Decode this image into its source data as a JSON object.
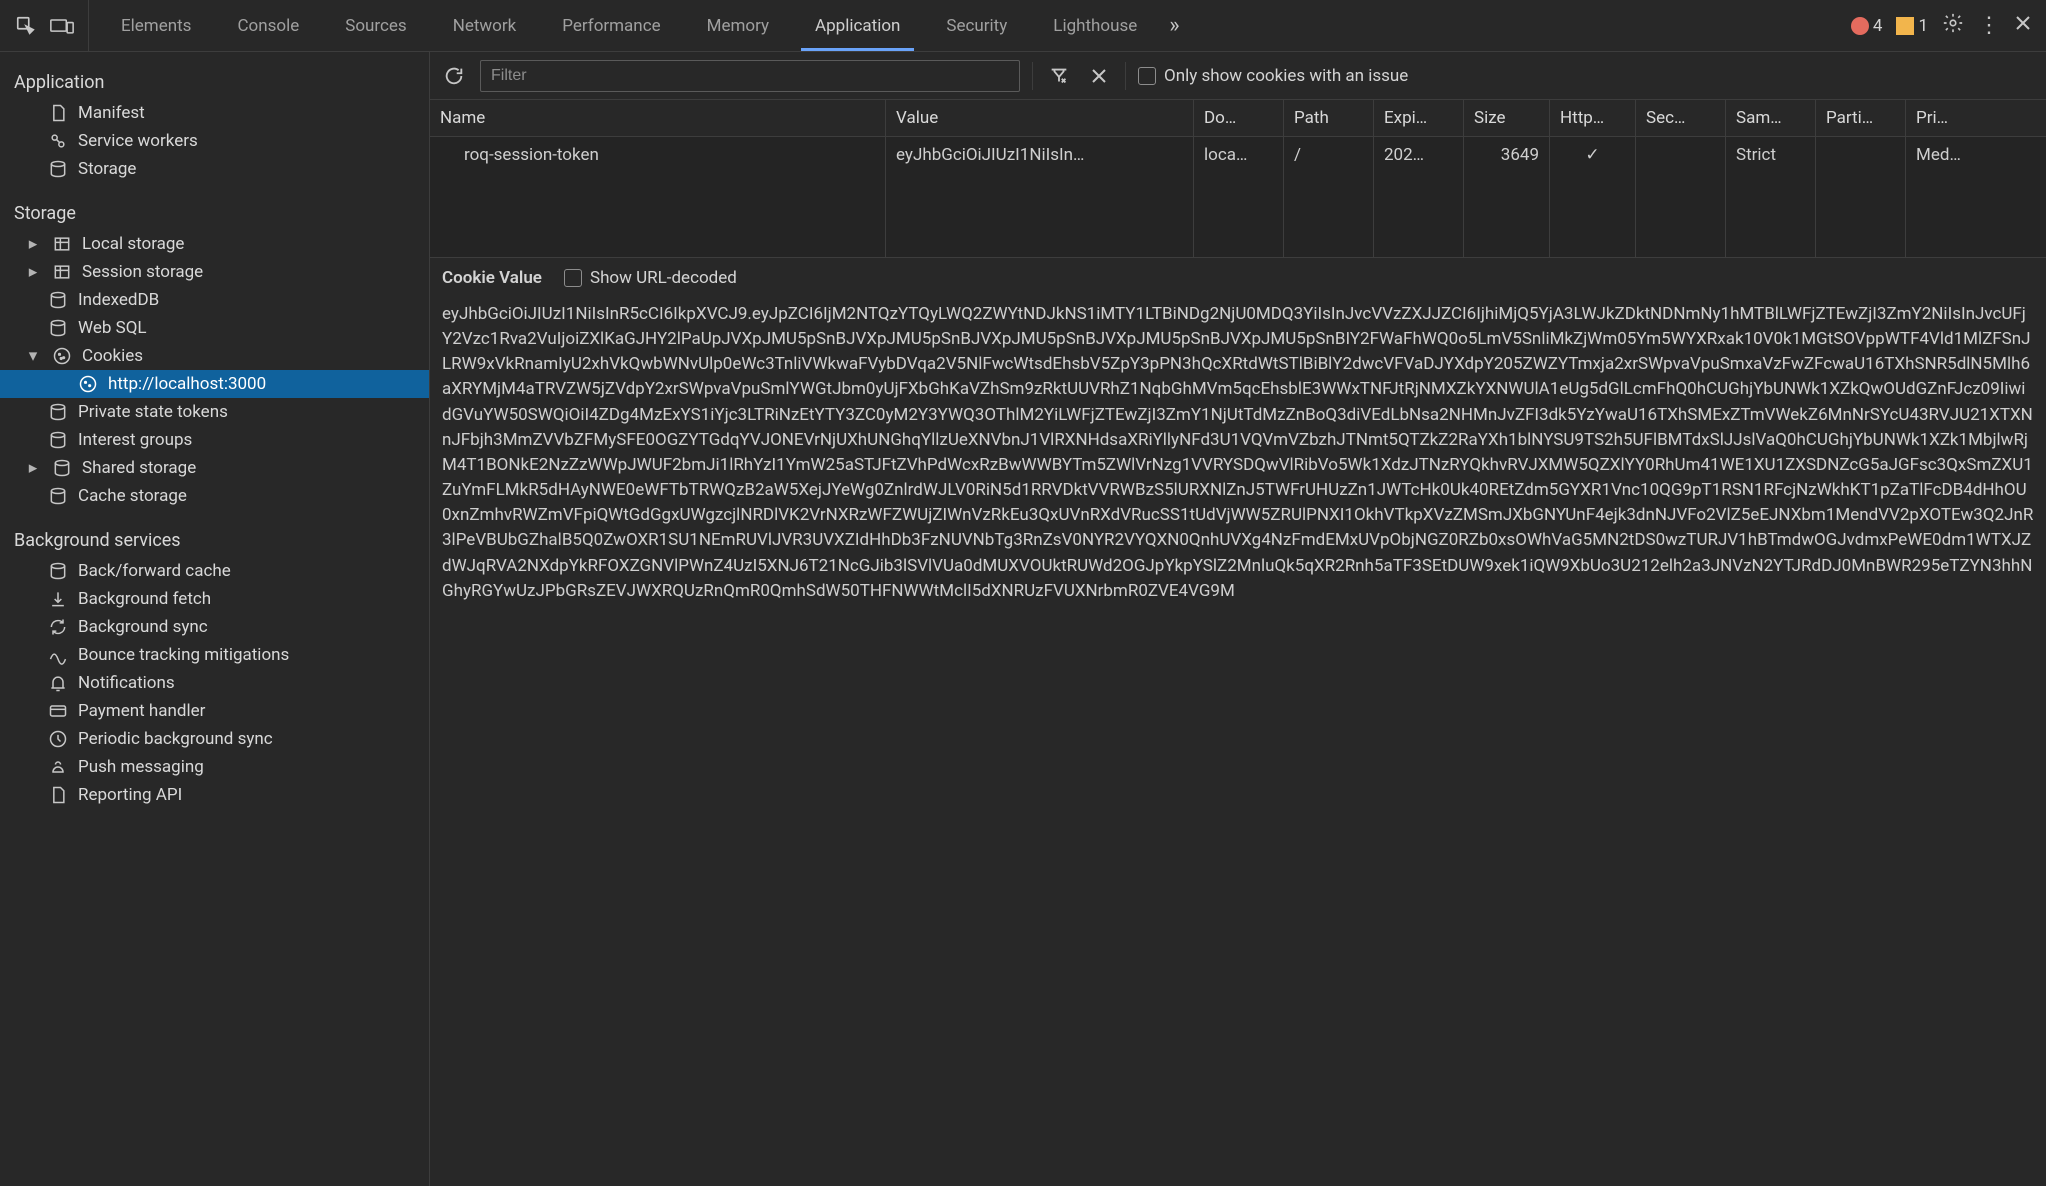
{
  "tabs": {
    "items": [
      "Elements",
      "Console",
      "Sources",
      "Network",
      "Performance",
      "Memory",
      "Application",
      "Security",
      "Lighthouse"
    ],
    "active": "Application"
  },
  "top_right": {
    "error_count": "4",
    "warn_count": "1"
  },
  "sidebar": {
    "sections": {
      "application": {
        "title": "Application",
        "items": [
          "Manifest",
          "Service workers",
          "Storage"
        ]
      },
      "storage": {
        "title": "Storage",
        "items": {
          "local_storage": "Local storage",
          "session_storage": "Session storage",
          "indexeddb": "IndexedDB",
          "websql": "Web SQL",
          "cookies": "Cookies",
          "cookies_child": "http://localhost:3000",
          "private_state_tokens": "Private state tokens",
          "interest_groups": "Interest groups",
          "shared_storage": "Shared storage",
          "cache_storage": "Cache storage"
        }
      },
      "background": {
        "title": "Background services",
        "items": [
          "Back/forward cache",
          "Background fetch",
          "Background sync",
          "Bounce tracking mitigations",
          "Notifications",
          "Payment handler",
          "Periodic background sync",
          "Push messaging",
          "Reporting API"
        ]
      }
    }
  },
  "toolbar": {
    "filter_placeholder": "Filter",
    "only_issue_label": "Only show cookies with an issue"
  },
  "table": {
    "headers": [
      "Name",
      "Value",
      "Do…",
      "Path",
      "Expi…",
      "Size",
      "Http…",
      "Sec…",
      "Sam…",
      "Parti…",
      "Pri…"
    ],
    "rows": [
      {
        "name": "roq-session-token",
        "value": "eyJhbGciOiJIUzI1NiIsIn…",
        "domain": "loca…",
        "path": "/",
        "expires": "202…",
        "size": "3649",
        "httponly": "✓",
        "secure": "",
        "samesite": "Strict",
        "partition": "",
        "priority": "Med…"
      }
    ]
  },
  "detail": {
    "label": "Cookie Value",
    "show_decoded_label": "Show URL-decoded",
    "value": "eyJhbGciOiJIUzI1NiIsInR5cCI6IkpXVCJ9.eyJpZCI6IjM2NTQzYTQyLWQ2ZWYtNDJkNS1iMTY1LTBiNDg2NjU0MDQ3YiIsInJvcVVzZXJJZCI6IjhiMjQ5YjA3LWJkZDktNDNmNy1hMTBlLWFjZTEwZjI3ZmY2NiIsInJvcUFjY2Vzc1Rva2VuIjoiZXlKaGJHY2lPaUpJVXpJMU5pSnBJVXpJMU5pSnBJVXpJMU5pSnBJVXpJMU5pSnBJVXpJMU5pSnBIY2FWaFhWQ0o5LmV5SnliMkZjWm05Ym5WYXRxak10V0k1MGtSOVppWTF4Vld1MlZFSnJLRW9xVkRnamIyU2xhVkQwbWNvUlp0eWc3TnliVWkwaFVybDVqa2V5NlFwcWtsdEhsbV5ZpY3pPN3hQcXRtdWtSTlBiBlY2dwcVFVaDJYXdpY205ZWZYTmxja2xrSWpvaVpuSmxaVzFwZFcwaU16TXhSNR5dlN5Mlh6aXRYMjM4aTRVZW5jZVdpY2xrSWpvaVpuSmlYWGtJbm0yUjFXbGhKaVZhSm9zRktUUVRhZ1NqbGhMVm5qcEhsblE3WWxTNFJtRjNMXZkYXNWUlA1eUg5dGlLcmFhQ0hCUGhjYbUNWk1XZkQwOUdGZnFJcz09IiwidGVuYW50SWQiOiI4ZDg4MzExYS1iYjc3LTRiNzEtYTY3ZC0yM2Y3YWQ3OThlM2YiLWFjZTEwZjI3ZmY1NjUtTdMzZnBoQ3diVEdLbNsa2NHMnJvZFI3dk5YzYwaU16TXhSMExZTmVWekZ6MnNrSYcU43RVJU21XTXNnJFbjh3MmZVVbZFMySFE0OGZYTGdqYVJONEVrNjUXhUNGhqYllzUeXNVbnJ1VlRXNHdsaXRiYllyNFd3U1VQVmVZbzhJTNmt5QTZkZ2RaYXh1blNYSU9TS2h5UFlBMTdxSlJJslVaQ0hCUGhjYbUNWk1XZk1MbjlwRjM4T1BONkE2NzZzWWpJWUF2bmJi1lRhYzI1YmW25aSTJFtZVhPdWcxRzBwWWBYTm5ZWlVrNzg1VVRYSDQwVlRibVo5Wk1XdzJTNzRYQkhvRVJXMW5QZXlYY0RhUm41WE1XU1ZXSDNZcG5aJGFsc3QxSmZXU1ZuYmFLMkR5dHAyNWE0eWFTbTRWQzB2aW5XejJYeWg0ZnlrdWJLV0RiN5d1RRVDktVVRWBzS5lURXNlZnJ5TWFrUHUzZn1JWTcHk0Uk40REtZdm5GYXR1Vnc10QG9pT1RSN1RFcjNzWkhKT1pZaTlFcDB4dHhOU0xnZmhvRWZmVFpiQWtGdGgxUWgzcjlNRDlVK2VrNXRzWFZWUjZIWnVzRkEu3QxUVnRXdVRucSS1tUdVjWW5ZRUlPNXI1OkhVTkpXVzZMSmJXbGNYUnF4ejk3dnNJVFo2VlZ5eEJNXbm1MendVV2pXOTEw3Q2JnR3lPeVBUbGZhalB5Q0ZwOXR1SU1NEmRUVlJVR3UVXZIdHhDb3FzNUVNbTg3RnZsV0NYR2VYQXN0QnhUVXg4NzFmdEMxUVpObjNGZ0RZb0xsOWhVaG5MN2tDS0wzTURJV1hBTmdwOGJvdmxPeWE0dm1WTXJZdWJqRVA2NXdpYkRFOXZGNVlPWnZ4UzI5XNJ6T21NcGJib3lSVlVUa0dMUXVOUktRUWd2OGJpYkpYSlZ2MnluQk5qXR2Rnh5aTF3SEtDUW9xek1iQW9XbUo3U212elh2a3JNVzN2YTJRdDJ0MnBWR295eTZYN3hhNGhyRGYwUzJPbGRsZEVJWXRQUzRnQmR0QmhSdW50THFNWWtMclI5dXNRUzFVUXNrbmR0ZVE4VG9M"
  }
}
